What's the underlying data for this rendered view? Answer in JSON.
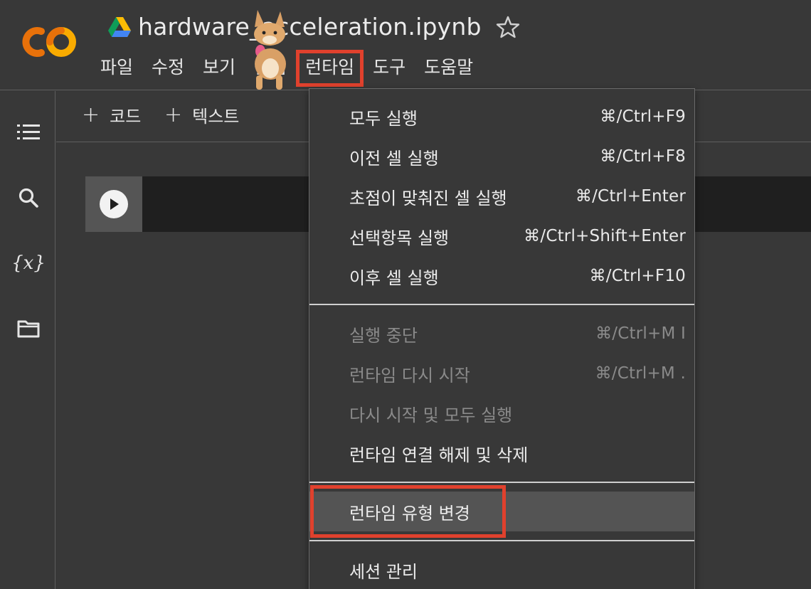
{
  "app": {
    "name": "Colab",
    "doc_title": "hardware_acceleration.ipynb",
    "logo_text": "CO"
  },
  "menubar": {
    "items": [
      {
        "label": "파일"
      },
      {
        "label": "수정"
      },
      {
        "label": "보기"
      },
      {
        "label": "삽입"
      },
      {
        "label": "런타임",
        "active": true
      },
      {
        "label": "도구"
      },
      {
        "label": "도움말"
      }
    ]
  },
  "toolbar": {
    "add_code": "코드",
    "add_text": "텍스트",
    "plus": "+"
  },
  "sidebar": {
    "icons": [
      "toc-icon",
      "search-icon",
      "variables-icon",
      "folder-icon"
    ],
    "variables_label": "{x}"
  },
  "runtime_menu": {
    "items": [
      {
        "label": "모두 실행",
        "shortcut": "⌘/Ctrl+F9",
        "disabled": false
      },
      {
        "label": "이전 셀 실행",
        "shortcut": "⌘/Ctrl+F8",
        "disabled": false
      },
      {
        "label": "초점이 맞춰진 셀 실행",
        "shortcut": "⌘/Ctrl+Enter",
        "disabled": false
      },
      {
        "label": "선택항목 실행",
        "shortcut": "⌘/Ctrl+Shift+Enter",
        "disabled": false
      },
      {
        "label": "이후 셀 실행",
        "shortcut": "⌘/Ctrl+F10",
        "disabled": false
      },
      {
        "label": "실행 중단",
        "shortcut": "⌘/Ctrl+M I",
        "disabled": true
      },
      {
        "label": "런타임 다시 시작",
        "shortcut": "⌘/Ctrl+M .",
        "disabled": true
      },
      {
        "label": "다시 시작 및 모두 실행",
        "shortcut": "",
        "disabled": true
      },
      {
        "label": "런타임 연결 해제 및 삭제",
        "shortcut": "",
        "disabled": false
      },
      {
        "label": "런타임 유형 변경",
        "shortcut": "",
        "disabled": false,
        "highlighted": true
      },
      {
        "label": "세션 관리",
        "shortcut": "",
        "disabled": false
      }
    ]
  },
  "colors": {
    "background": "#383838",
    "highlight_red": "#e0412d",
    "colab_orange": "#f9ab00",
    "colab_dark_orange": "#e8710a"
  }
}
